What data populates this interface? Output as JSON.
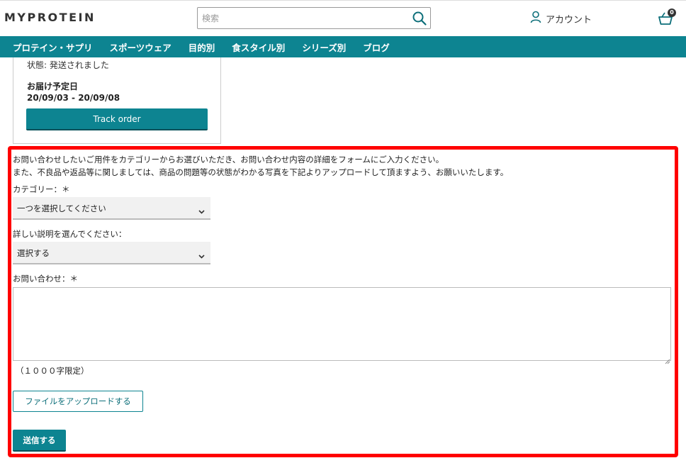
{
  "header": {
    "logo": "MYPROTEIN",
    "search_placeholder": "検索",
    "search_icon": "search-icon",
    "account_label": "アカウント",
    "account_icon": "user-icon",
    "basket_icon": "basket-icon",
    "basket_count": "0"
  },
  "nav": {
    "items": [
      "プロテイン・サプリ",
      "スポーツウェア",
      "目的別",
      "食スタイル別",
      "シリーズ別",
      "ブログ"
    ]
  },
  "order": {
    "status": "状態: 発送されました",
    "eta_label": "お届け予定日",
    "eta_value": "20/09/03 - 20/09/08",
    "track_button": "Track order"
  },
  "form": {
    "intro_line1": "お問い合わせしたいご用件をカテゴリーからお選びいただき、お問い合わせ内容の詳細をフォームにご入力ください。",
    "intro_line2": "また、不良品や返品等に関しましては、商品の問題等の状態がわかる写真を下記よりアップロードして頂ますよう、お願いいたします。",
    "category_label": "カテゴリー：＊",
    "category_value": "一つを選択してください",
    "detail_label": "詳しい説明を選んでください：",
    "detail_value": "選択する",
    "message_label": "お問い合わせ：＊",
    "message_value": "",
    "limit_note": "（１０００字限定）",
    "upload_button": "ファイルをアップロードする",
    "submit_button": "送信する"
  },
  "colors": {
    "brand_teal": "#0d8491",
    "highlight_red": "#ff0000"
  }
}
